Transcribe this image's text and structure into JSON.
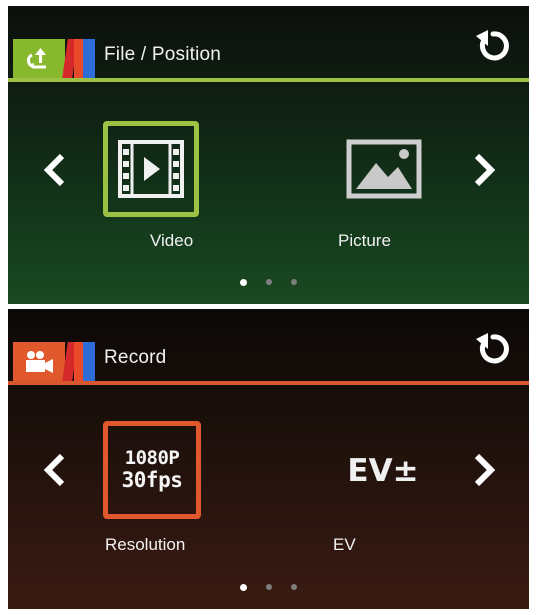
{
  "panels": [
    {
      "title": "File / Position",
      "accent": "#9bc242",
      "badge_icon": "file-position-icon",
      "back_icon": "refresh-back-icon",
      "items": [
        {
          "label": "Video",
          "icon": "video-icon",
          "selected": true
        },
        {
          "label": "Picture",
          "icon": "picture-icon",
          "selected": false
        }
      ],
      "page_indicator": {
        "total": 3,
        "active": 1
      }
    },
    {
      "title": "Record",
      "accent": "#e0582c",
      "badge_icon": "video-camera-icon",
      "back_icon": "refresh-back-icon",
      "items": [
        {
          "label": "Resolution",
          "value_line1": "1080P",
          "value_line2": "30fps",
          "selected": true
        },
        {
          "label": "EV",
          "value": "EV±",
          "selected": false
        }
      ],
      "page_indicator": {
        "total": 3,
        "active": 1
      }
    }
  ]
}
